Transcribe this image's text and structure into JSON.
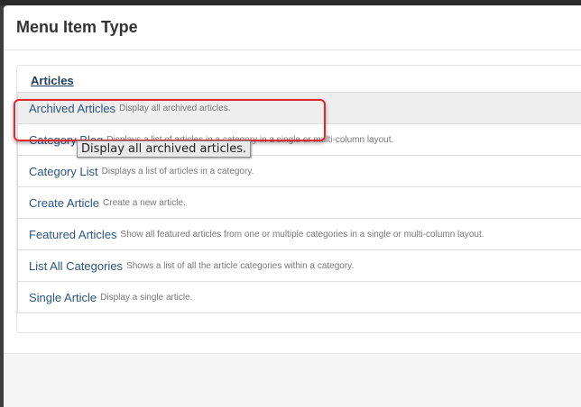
{
  "modal": {
    "title": "Menu Item Type"
  },
  "section": {
    "heading": "Articles"
  },
  "items": [
    {
      "title": "Archived Articles",
      "description": "Display all archived articles."
    },
    {
      "title": "Category Blog",
      "description": "Displays a list of articles in a category in a single or multi-column layout."
    },
    {
      "title": "Category List",
      "description": "Displays a list of articles in a category."
    },
    {
      "title": "Create Article",
      "description": "Create a new article."
    },
    {
      "title": "Featured Articles",
      "description": "Show all featured articles from one or multiple categories in a single or multi-column layout."
    },
    {
      "title": "List All Categories",
      "description": "Shows a list of all the article categories within a category."
    },
    {
      "title": "Single Article",
      "description": "Display a single article."
    }
  ],
  "tooltip": {
    "text": "Display all archived articles."
  },
  "colors": {
    "highlight": "#e0282e",
    "link": "#2a5585",
    "heading_link": "#1f3b5c"
  }
}
